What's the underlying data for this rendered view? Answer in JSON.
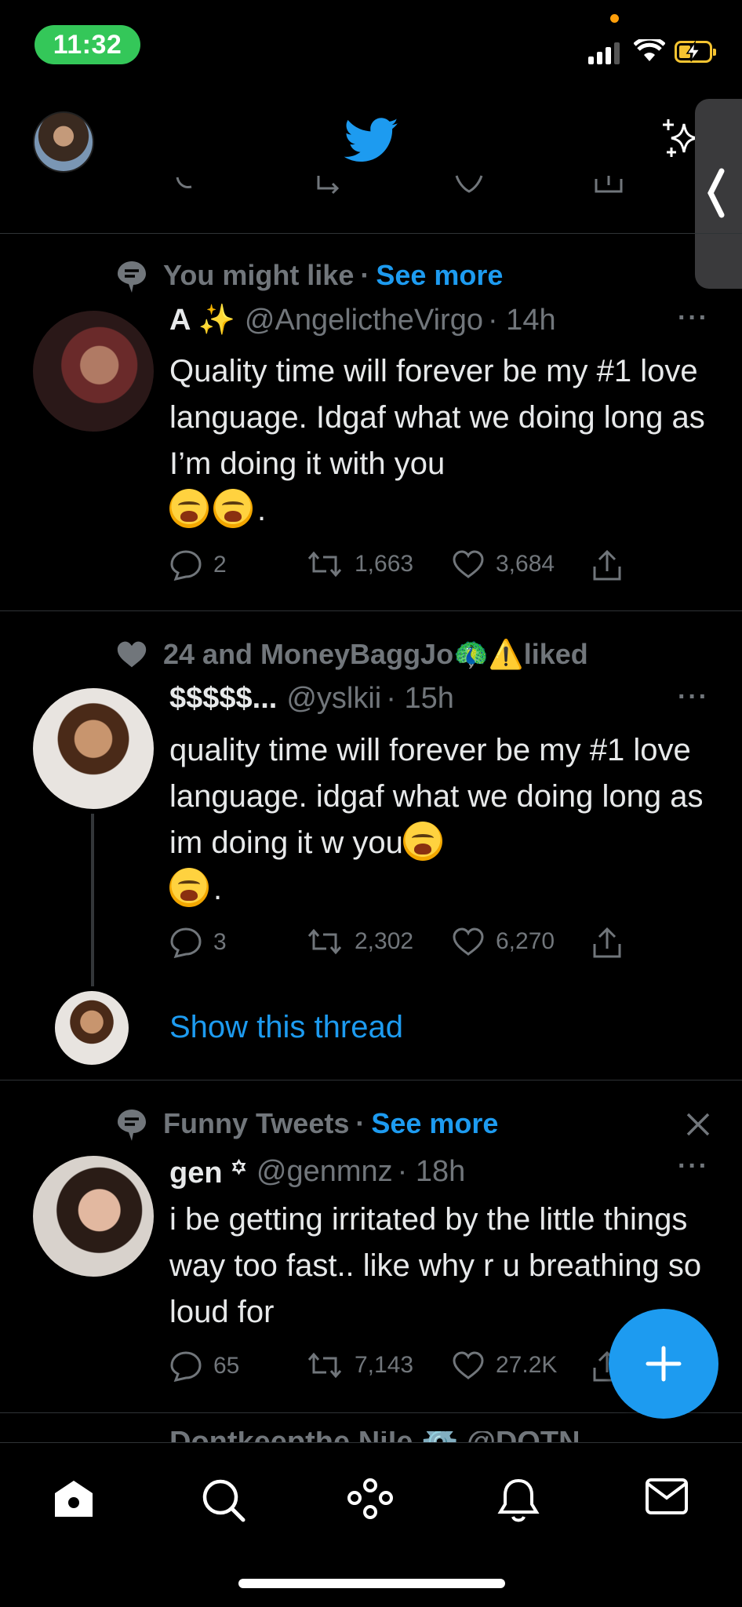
{
  "status_bar": {
    "time": "11:32"
  },
  "header": {
    "logo": "twitter-bird-icon",
    "accent": "#1d9bf0"
  },
  "tweets": [
    {
      "context_label": "You might like",
      "context_separator": "·",
      "context_link": "See more",
      "display_name": "A ✨",
      "handle": "@AngelictheVirgo",
      "time": "· 14h",
      "text": "Quality time will forever be my #1 love language. Idgaf what we doing long as I’m doing it with you",
      "text_suffix": ".",
      "replies": "2",
      "retweets": "1,663",
      "likes": "3,684"
    },
    {
      "context_label": "24 and MoneyBaggJo🦚⚠️liked",
      "display_name": "$$$$$...",
      "handle": "@yslkii",
      "time": "· 15h",
      "text": "quality time will forever be my #1 love language. idgaf what we doing long as im doing it w you",
      "text_suffix": ".",
      "replies": "3",
      "retweets": "2,302",
      "likes": "6,270",
      "show_thread": "Show this thread"
    },
    {
      "context_label": "Funny Tweets",
      "context_separator": "·",
      "context_link": "See more",
      "display_name": "gen ꙳",
      "handle": "@genmnz",
      "time": "· 18h",
      "text": "i be getting irritated by the little things way too fast.. like why r u breathing so loud for",
      "replies": "65",
      "retweets": "7,143",
      "likes": "27.2K"
    }
  ],
  "more_menu": "···",
  "peek_text": "Dontkeepthe Nile ⚙️ @DOTN"
}
